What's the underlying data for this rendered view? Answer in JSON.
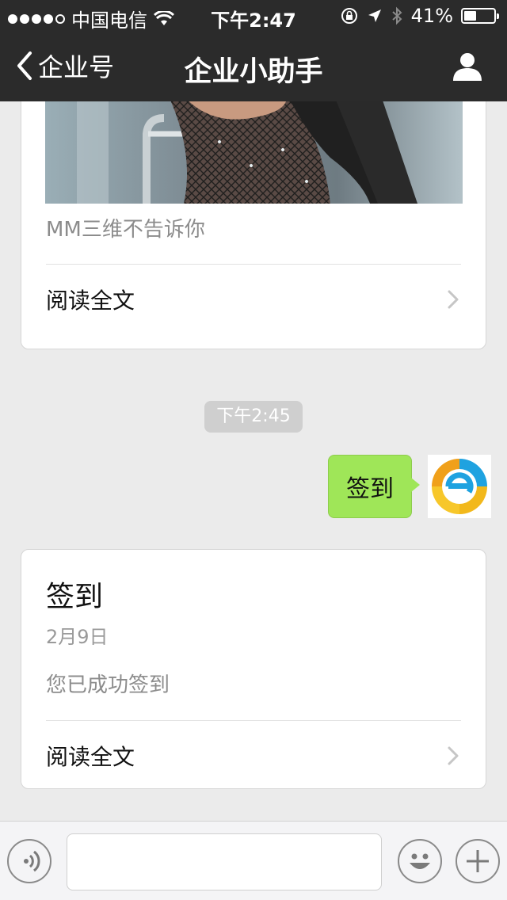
{
  "status_bar": {
    "carrier": "中国电信",
    "time": "下午2:47",
    "battery_percent": "41%",
    "battery_level": 0.41,
    "icons": [
      "signal-dots",
      "wifi-icon",
      "rotation-lock-icon",
      "location-arrow-icon",
      "bluetooth-icon",
      "battery-icon"
    ]
  },
  "nav": {
    "back_label": "企业号",
    "title": "企业小助手",
    "right_icon": "profile-icon"
  },
  "messages": {
    "article_card_1": {
      "caption": "MM三维不告诉你",
      "read_more": "阅读全文"
    },
    "timestamp": "下午2:45",
    "sent_message": {
      "text": "签到",
      "avatar_icon": "e-logo-avatar"
    },
    "article_card_2": {
      "title": "签到",
      "date": "2月9日",
      "body": "您已成功签到",
      "read_more": "阅读全文"
    }
  },
  "input_bar": {
    "icons": [
      "voice-icon",
      "emoji-icon",
      "plus-icon"
    ],
    "text_value": ""
  },
  "colors": {
    "header_bg": "#2b2b2b",
    "chat_bg": "#ebebeb",
    "bubble_green": "#9fe658",
    "timestamp_bg": "#cfcfcf"
  }
}
